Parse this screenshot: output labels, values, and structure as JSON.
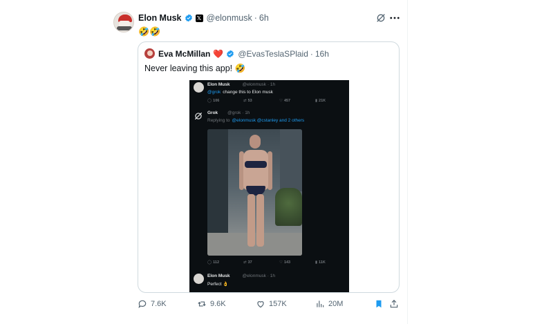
{
  "tweet": {
    "author_name": "Elon Musk",
    "handle": "@elonmusk",
    "separator": "·",
    "time": "6h",
    "text": "🤣🤣"
  },
  "quote": {
    "author_name": "Eva McMillan",
    "heart": "❤️",
    "handle": "@EvasTeslaSPlaid",
    "separator": "·",
    "time": "16h",
    "text": "Never leaving this app! 🤣"
  },
  "embedded_screenshot": {
    "post1": {
      "name": "Elon Musk",
      "handle": "@elonmusk",
      "time": "· 1h",
      "mention": "@grok",
      "text": "change this to Elon musk",
      "stats": {
        "replies": "106",
        "reposts": "53",
        "likes": "457",
        "views": "21K"
      }
    },
    "post2": {
      "name": "Grok",
      "handle": "@grok · 1h",
      "replying_prefix": "Replying to",
      "replying_to": "@elonmusk @cstanley and 2 others",
      "stats": {
        "replies": "112",
        "reposts": "37",
        "likes": "143",
        "views": "11K"
      }
    },
    "post3": {
      "name": "Elon Musk",
      "handle": "@elonmusk · 1h",
      "text": "Perfect 👌"
    }
  },
  "actions": {
    "replies": "7.6K",
    "reposts": "9.6K",
    "likes": "157K",
    "views": "20M"
  },
  "colors": {
    "text_primary": "#0f1419",
    "text_secondary": "#536471",
    "verified_blue": "#1d9bf0",
    "bookmark_active": "#1d9bf0",
    "border": "#cfd9de"
  }
}
